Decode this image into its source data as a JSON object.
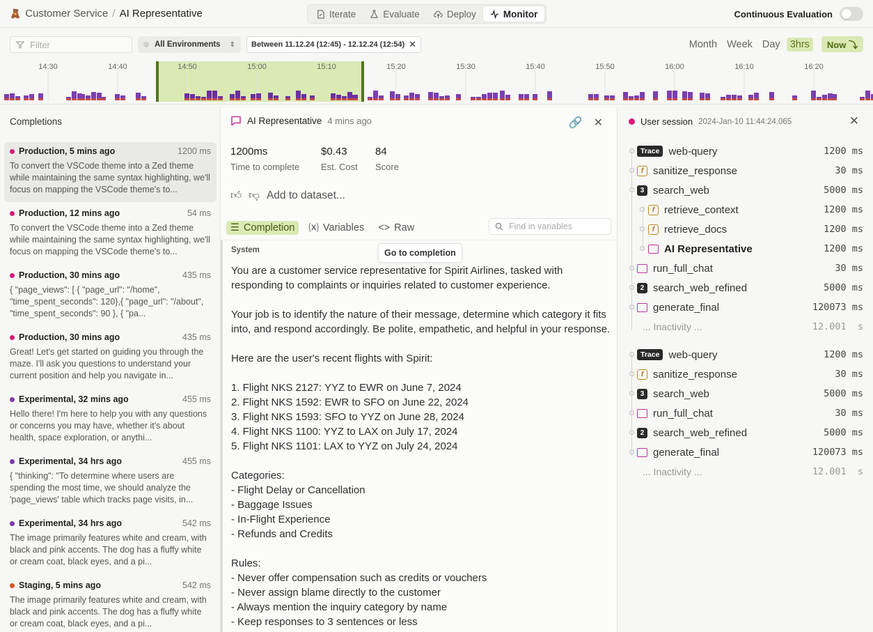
{
  "topbar": {
    "breadcrumb": [
      "Customer Service",
      "AI Representative"
    ],
    "tabs": [
      {
        "label": "Iterate",
        "icon": "file-edit-icon"
      },
      {
        "label": "Evaluate",
        "icon": "flask-icon"
      },
      {
        "label": "Deploy",
        "icon": "cloud-upload-icon"
      },
      {
        "label": "Monitor",
        "icon": "activity-icon",
        "active": true
      }
    ],
    "continuous_evaluation": "Continuous Evaluation",
    "continuous_evaluation_enabled": false
  },
  "filters": {
    "search_placeholder": "Filter",
    "environment": "All Environments",
    "date_range": "Between 11.12.24 (12:45) - 12.12.24 (12:54)",
    "ranges": [
      "Month",
      "Week",
      "Day",
      "3hrs"
    ],
    "selected_range": "3hrs",
    "now_label": "Now"
  },
  "timeline": {
    "ticks": [
      "14:30",
      "14:40",
      "14:50",
      "15:00",
      "15:10",
      "15:20",
      "15:30",
      "15:40",
      "15:50",
      "16:00",
      "16:10",
      "16:20"
    ]
  },
  "completions": {
    "header": "Completions",
    "items": [
      {
        "env": "Production, 5 mins ago",
        "color": "#d81b78",
        "ms": "1200 ms",
        "text": "To convert the VSCode theme into a Zed theme while maintaining the same syntax highlighting, we'll focus on mapping the VSCode theme's to...",
        "selected": true
      },
      {
        "env": "Production, 12 mins ago",
        "color": "#d81b78",
        "ms": "54 ms",
        "text": "To convert the VSCode theme into a Zed theme while maintaining the same syntax highlighting, we'll focus on mapping the VSCode theme's to..."
      },
      {
        "env": "Production, 30 mins ago",
        "color": "#d81b78",
        "ms": "435 ms",
        "text": "{ \"page_views\": [ {  \"page_url\": \"/home\", \"time_spent_seconds\": 120},{  \"page_url\": \"/about\",  \"time_spent_seconds\": 90   },   {   \"pa..."
      },
      {
        "env": "Production, 30 mins ago",
        "color": "#d81b78",
        "ms": "435 ms",
        "text": "Great! Let's get started on guiding you through the maze. I'll ask you questions to understand your current position and help you navigate in..."
      },
      {
        "env": "Experimental, 32 mins ago",
        "color": "#7a3aa8",
        "ms": "455 ms",
        "text": "Hello there! I'm here to help you with any questions or concerns you may have, whether it's about health, space exploration, or anythi..."
      },
      {
        "env": "Experimental, 34 hrs ago",
        "color": "#7a3aa8",
        "ms": "455 ms",
        "text": "{ \"thinking\": \"To determine where users are spending the most time, we should analyze the 'page_views' table which tracks page visits, in..."
      },
      {
        "env": "Experimental, 34 hrs ago",
        "color": "#7a3aa8",
        "ms": "542 ms",
        "text": "The image primarily features white and cream, with black and pink accents. The dog has a fluffy white or cream coat, black eyes, and a pi..."
      },
      {
        "env": "Staging, 5 mins ago",
        "color": "#d2571c",
        "ms": "542 ms",
        "text": "The image primarily features white and cream, with black and pink accents. The dog has a fluffy white or cream coat, black eyes, and a pi..."
      }
    ]
  },
  "detail": {
    "title": "AI Representative",
    "ago": "4 mins ago",
    "stats": [
      {
        "value": "1200ms",
        "label": "Time to complete"
      },
      {
        "value": "$0.43",
        "label": "Est. Cost"
      },
      {
        "value": "84",
        "label": "Score"
      }
    ],
    "add_to_dataset": "Add to dataset...",
    "tabs": [
      "Completion",
      "Variables",
      "Raw"
    ],
    "find_placeholder": "Find in variables",
    "system_label": "System",
    "tooltip": "Go to completion",
    "system_text": "You are a customer service representative for Spirit Airlines, tasked with responding to complaints or inquiries related to customer experience.\n\nYour job is to identify the nature of their message, determine which category it fits into, and respond accordingly. Be polite, empathetic, and helpful in your response.\n\nHere are the user's recent flights with Spirit:\n\n1. Flight NKS 2127: YYZ to EWR on June 7, 2024\n2. Flight NKS 1592: EWR to SFO on June 22, 2024\n3. Flight NKS 1593: SFO to YYZ on June 28, 2024\n4. Flight NKS 1100: YYZ to LAX on July 17, 2024\n5. Flight NKS 1101: LAX to YYZ on July 24, 2024\n\nCategories:\n- Flight Delay or Cancellation\n- Baggage Issues\n- In-Flight Experience\n- Refunds and Credits\n\nRules:\n- Never offer compensation such as credits or vouchers\n- Never assign blame directly to the customer\n- Always mention the inquiry category by name\n- Keep responses to 3 sentences or less"
  },
  "session": {
    "title": "User session",
    "timestamp": "2024-Jan-10 11:44:24.065",
    "rows": [
      {
        "kind": "trace",
        "badge": "Trace",
        "label": "web-query",
        "value": "1200 ms",
        "indent": 0
      },
      {
        "kind": "fn",
        "label": "sanitize_response",
        "value": "30 ms",
        "indent": 0
      },
      {
        "kind": "num",
        "badge": "3",
        "label": "search_web",
        "value": "5000 ms",
        "indent": 0
      },
      {
        "kind": "fn",
        "label": "retrieve_context",
        "value": "1200 ms",
        "indent": 1
      },
      {
        "kind": "fn",
        "label": "retrieve_docs",
        "value": "1200 ms",
        "indent": 1
      },
      {
        "kind": "chat",
        "label": "AI Representative",
        "value": "1200 ms",
        "indent": 1,
        "bold": true
      },
      {
        "kind": "chat",
        "label": "run_full_chat",
        "value": "30 ms",
        "indent": 0
      },
      {
        "kind": "num",
        "badge": "2",
        "label": "search_web_refined",
        "value": "5000 ms",
        "indent": 0
      },
      {
        "kind": "chat",
        "label": "generate_final",
        "value": "120073 ms",
        "indent": 0
      },
      {
        "kind": "inactivity",
        "label": "... Inactivity ...",
        "value": "12.001  s",
        "indent": 0
      },
      {
        "kind": "trace",
        "badge": "Trace",
        "label": "web-query",
        "value": "1200 ms",
        "indent": 0
      },
      {
        "kind": "fn",
        "label": "sanitize_response",
        "value": "30 ms",
        "indent": 0
      },
      {
        "kind": "num",
        "badge": "3",
        "label": "search_web",
        "value": "5000 ms",
        "indent": 0
      },
      {
        "kind": "chat",
        "label": "run_full_chat",
        "value": "30 ms",
        "indent": 0
      },
      {
        "kind": "num",
        "badge": "2",
        "label": "search_web_refined",
        "value": "5000 ms",
        "indent": 0
      },
      {
        "kind": "chat",
        "label": "generate_final",
        "value": "120073 ms",
        "indent": 0
      },
      {
        "kind": "inactivity",
        "label": "... Inactivity ...",
        "value": "12.001  s",
        "indent": 0
      }
    ]
  }
}
